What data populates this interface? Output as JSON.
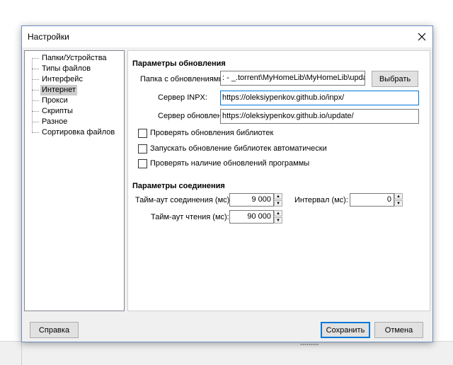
{
  "dialog": {
    "title": "Настройки"
  },
  "tree": {
    "items": [
      {
        "label": "Папки/Устройства"
      },
      {
        "label": "Типы файлов"
      },
      {
        "label": "Интерфейс"
      },
      {
        "label": "Интернет",
        "selected": true
      },
      {
        "label": "Прокси"
      },
      {
        "label": "Скрипты"
      },
      {
        "label": "Разное"
      },
      {
        "label": "Сортировка файлов"
      }
    ]
  },
  "update_params": {
    "title": "Параметры обновления",
    "folder_label": "Папка с обновлениями:",
    "folder_value": ": - _.torrent\\MyHomeLib\\MyHomeLib\\update",
    "browse_label": "Выбрать",
    "inpx_label": "Сервер INPX:",
    "inpx_value": "https://oleksiypenkov.github.io/inpx/",
    "update_server_label": "Сервер обновлений:",
    "update_server_value": "https://oleksiypenkov.github.io/update/",
    "checkboxes": [
      {
        "label": "Проверять обновления библиотек",
        "checked": false
      },
      {
        "label": "Запускать обновление библиотек автоматически",
        "checked": false
      },
      {
        "label": "Проверять наличие обновлений программы",
        "checked": false
      }
    ]
  },
  "connection_params": {
    "title": "Параметры соединения",
    "connect_timeout_label": "Тайм-аут соединения (мс):",
    "connect_timeout_value": "9 000",
    "interval_label": "Интервал (мс):",
    "interval_value": "0",
    "read_timeout_label": "Тайм-аут чтения (мс):",
    "read_timeout_value": "90 000"
  },
  "footer": {
    "help_label": "Справка",
    "save_label": "Сохранить",
    "cancel_label": "Отмена"
  }
}
